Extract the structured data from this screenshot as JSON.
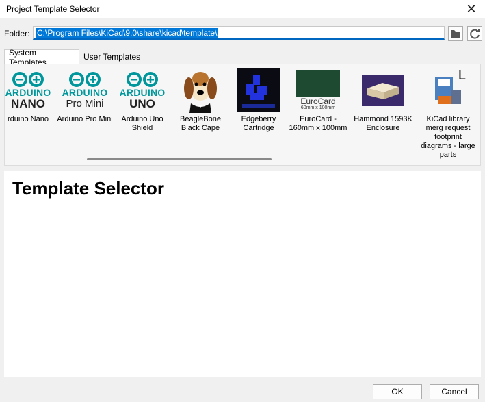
{
  "window": {
    "title": "Project Template Selector",
    "close_glyph": "✕"
  },
  "folder": {
    "label": "Folder:",
    "path": "C:\\Program Files\\KiCad\\9.0\\share\\kicad\\template\\",
    "browse_icon": "folder-icon",
    "refresh_icon": "refresh-icon"
  },
  "tabs": [
    {
      "label": "System Templates",
      "active": true
    },
    {
      "label": "User Templates",
      "active": false
    }
  ],
  "templates": [
    {
      "label": "rduino Nano",
      "logo_word": "ARDUINO",
      "logo_variant": "NANO"
    },
    {
      "label": "Arduino Pro Mini",
      "logo_word": "ARDUINO",
      "logo_variant": "Pro Mini"
    },
    {
      "label": "Arduino Uno Shield",
      "logo_word": "ARDUINO",
      "logo_variant": "UNO"
    },
    {
      "label": "BeagleBone Black Cape"
    },
    {
      "label": "Edgeberry Cartridge"
    },
    {
      "label": "EuroCard - 160mm x 100mm",
      "img_title": "EuroCard",
      "img_sub": "60mm x 100mm"
    },
    {
      "label": "Hammond 1593K Enclosure"
    },
    {
      "label": "KiCad library merg request footprint diagrams - large parts",
      "img_letter": "L"
    }
  ],
  "content": {
    "heading": "Template Selector"
  },
  "buttons": {
    "ok": "OK",
    "cancel": "Cancel"
  }
}
